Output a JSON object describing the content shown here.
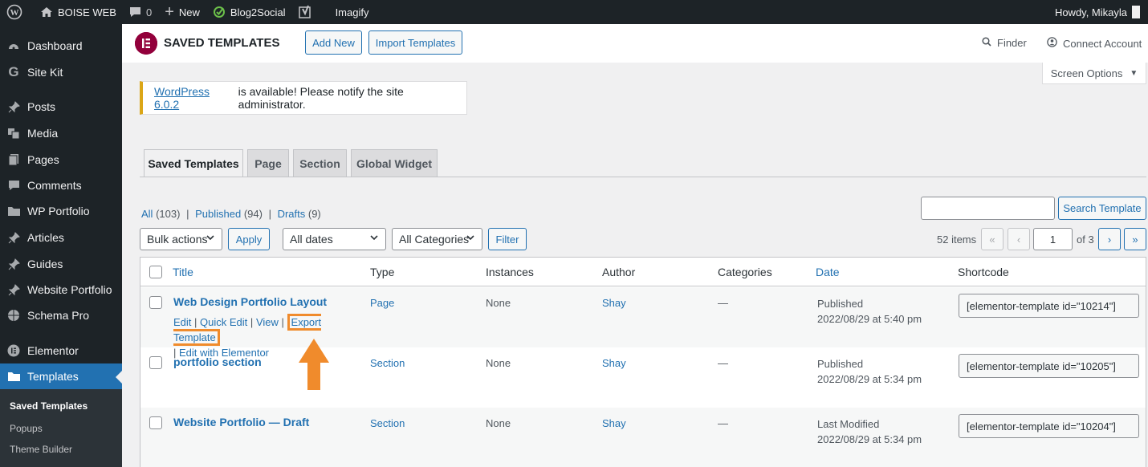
{
  "admin_bar": {
    "site_name": "BOISE WEB",
    "comments_count": "0",
    "new_label": "New",
    "blog2social_label": "Blog2Social",
    "imagify_label": "Imagify",
    "howdy": "Howdy, Mikayla"
  },
  "sidebar": {
    "items": [
      {
        "label": "Dashboard",
        "icon": "dashboard-icon"
      },
      {
        "label": "Site Kit",
        "icon": "google-icon"
      },
      {
        "label": "Posts",
        "icon": "pin-icon"
      },
      {
        "label": "Media",
        "icon": "media-icon"
      },
      {
        "label": "Pages",
        "icon": "pages-icon"
      },
      {
        "label": "Comments",
        "icon": "comment-icon"
      },
      {
        "label": "WP Portfolio",
        "icon": "folder-icon"
      },
      {
        "label": "Articles",
        "icon": "pin-icon"
      },
      {
        "label": "Guides",
        "icon": "pin-icon"
      },
      {
        "label": "Website Portfolio",
        "icon": "pin-icon"
      },
      {
        "label": "Schema Pro",
        "icon": "globe-icon"
      },
      {
        "label": "Elementor",
        "icon": "elementor-icon"
      },
      {
        "label": "Templates",
        "icon": "folder-icon"
      }
    ],
    "submenu": [
      {
        "label": "Saved Templates"
      },
      {
        "label": "Popups"
      },
      {
        "label": "Theme Builder"
      }
    ]
  },
  "header": {
    "logo_letter": "E",
    "title": "SAVED TEMPLATES",
    "add_new": "Add New",
    "import_templates": "Import Templates",
    "finder": "Finder",
    "connect_account": "Connect Account"
  },
  "screen_options": "Screen Options",
  "notice": {
    "link": "WordPress 6.0.2",
    "text": "is available! Please notify the site administrator."
  },
  "tabs": [
    {
      "label": "Saved Templates"
    },
    {
      "label": "Page"
    },
    {
      "label": "Section"
    },
    {
      "label": "Global Widget"
    }
  ],
  "views": {
    "all": "All",
    "all_count": "(103)",
    "published": "Published",
    "published_count": "(94)",
    "drafts": "Drafts",
    "drafts_count": "(9)",
    "sep": "|"
  },
  "filters": {
    "bulk_actions": "Bulk actions",
    "apply": "Apply",
    "all_dates": "All dates",
    "all_categories": "All Categories",
    "filter": "Filter",
    "search_button": "Search Template"
  },
  "pagination": {
    "items": "52 items",
    "first": "«",
    "prev": "‹",
    "current_page": "1",
    "of_total": "of 3",
    "next": "›",
    "last": "»"
  },
  "table": {
    "columns": [
      "Title",
      "Type",
      "Instances",
      "Author",
      "Categories",
      "Date",
      "Shortcode"
    ],
    "rows": [
      {
        "title": "Web Design Portfolio Layout",
        "type": "Page",
        "instances": "None",
        "author": "Shay",
        "categories": "—",
        "status": "Published",
        "date": "2022/08/29 at 5:40 pm",
        "shortcode": "[elementor-template id=\"10214\"]",
        "actions": {
          "edit": "Edit",
          "quick_edit": "Quick Edit",
          "view": "View",
          "export": "Export Template",
          "edit_elementor": "Edit with Elementor",
          "sep": "|"
        }
      },
      {
        "title": "portfolio section",
        "type": "Section",
        "instances": "None",
        "author": "Shay",
        "categories": "—",
        "status": "Published",
        "date": "2022/08/29 at 5:34 pm",
        "shortcode": "[elementor-template id=\"10205\"]"
      },
      {
        "title": "Website Portfolio — Draft",
        "type": "Section",
        "instances": "None",
        "author": "Shay",
        "categories": "—",
        "status": "Last Modified",
        "date": "2022/08/29 at 5:34 pm",
        "shortcode": "[elementor-template id=\"10204\"]"
      }
    ]
  },
  "colors": {
    "admin_dark": "#1d2327",
    "link_blue": "#2271b1",
    "highlight_orange": "#f08b2c",
    "elementor_red": "#92003b"
  }
}
